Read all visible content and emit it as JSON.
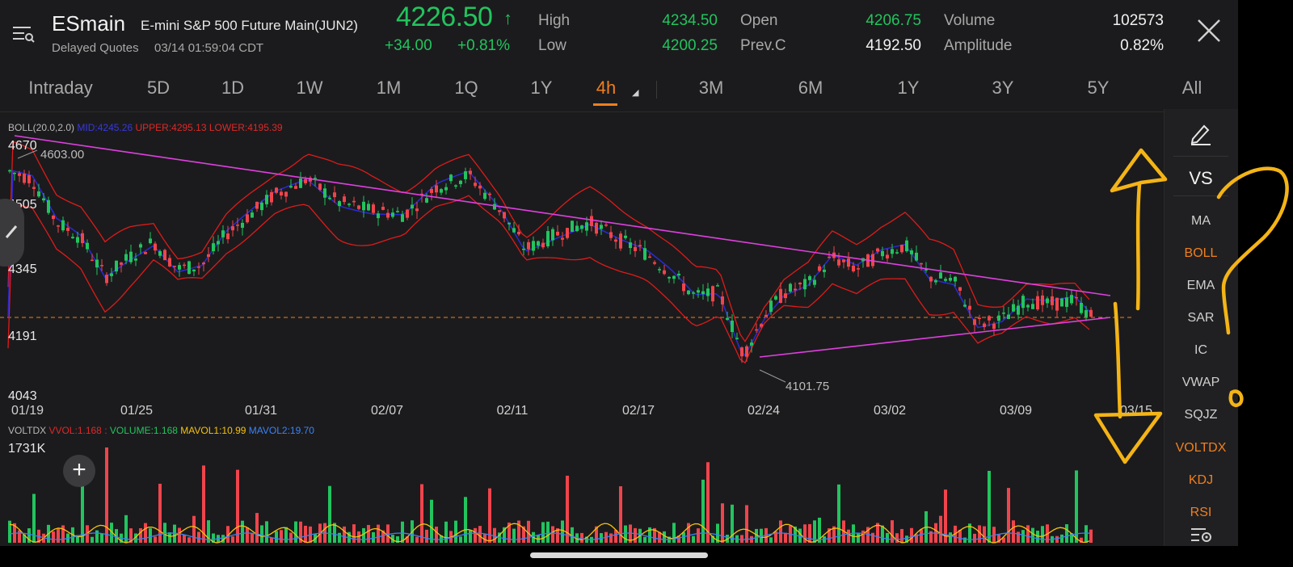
{
  "header": {
    "symbol": "ESmain",
    "full_name": "E-mini S&P 500 Future Main(JUN2)",
    "quote_status": "Delayed Quotes",
    "quote_time": "03/14 01:59:04 CDT",
    "price": "4226.50",
    "change": "+34.00",
    "change_pct": "+0.81%",
    "stats": {
      "high_label": "High",
      "high": "4234.50",
      "low_label": "Low",
      "low": "4200.25",
      "open_label": "Open",
      "open": "4206.75",
      "prev_close_label": "Prev.C",
      "prev_close": "4192.50",
      "volume_label": "Volume",
      "volume": "102573",
      "amplitude_label": "Amplitude",
      "amplitude": "0.82%"
    }
  },
  "tabs": [
    {
      "label": "Intraday"
    },
    {
      "label": "5D"
    },
    {
      "label": "1D"
    },
    {
      "label": "1W"
    },
    {
      "label": "1M"
    },
    {
      "label": "1Q"
    },
    {
      "label": "1Y"
    },
    {
      "label": "4h",
      "active": true
    },
    {
      "label": "3M"
    },
    {
      "label": "6M"
    },
    {
      "label": "1Y"
    },
    {
      "label": "3Y"
    },
    {
      "label": "5Y"
    },
    {
      "label": "All"
    }
  ],
  "chart": {
    "boll": {
      "name": "BOLL(20.0,2.0)",
      "mid": "MID:4245.26",
      "upper": "UPPER:4295.13",
      "lower": "LOWER:4195.39"
    },
    "y_labels": [
      "4670",
      "4505",
      "4345",
      "4191",
      "4043"
    ],
    "x_labels": [
      "01/19",
      "01/25",
      "01/31",
      "02/07",
      "02/11",
      "02/17",
      "02/24",
      "03/02",
      "03/09",
      "03/15"
    ],
    "annotations": {
      "high": "4603.00",
      "low": "4101.75"
    }
  },
  "volume_panel": {
    "name": "VOLTDX",
    "vvol": "VVOL:1.168",
    "sep": ":",
    "volume": "VOLUME:1.168",
    "mavol1": "MAVOL1:10.99",
    "mavol2": "MAVOL2:19.70",
    "max_label": "1731K",
    "add_label": "+"
  },
  "side_panel": {
    "items": [
      {
        "label": "VS",
        "active": false
      },
      {
        "label": "MA",
        "active": false
      },
      {
        "label": "BOLL",
        "active": true
      },
      {
        "label": "EMA",
        "active": false
      },
      {
        "label": "SAR",
        "active": false
      },
      {
        "label": "IC",
        "active": false
      },
      {
        "label": "VWAP",
        "active": false
      },
      {
        "label": "SQJZ",
        "active": false
      },
      {
        "label": "VOLTDX",
        "active": true
      },
      {
        "label": "KDJ",
        "active": true
      },
      {
        "label": "RSI",
        "active": true
      }
    ]
  },
  "colors": {
    "up": "#22c45e",
    "down": "#f0444c",
    "accent": "#f07f1e",
    "boll_band": "#e01a1a",
    "boll_mid": "#2a2ad8",
    "trend_lines": "#e040e0",
    "annotation_ink": "#f4b416"
  },
  "icons": [
    "menu-icon",
    "up-arrow-icon",
    "close-icon",
    "pencil-icon",
    "settings-icon"
  ]
}
